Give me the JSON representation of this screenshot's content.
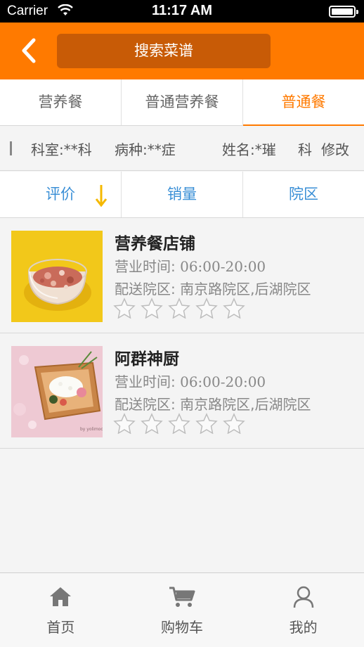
{
  "status_bar": {
    "carrier": "Carrier",
    "time": "11:17 AM"
  },
  "header": {
    "search_label": "搜索菜谱"
  },
  "tabs": [
    {
      "label": "营养餐",
      "active": false
    },
    {
      "label": "普通营养餐",
      "active": false
    },
    {
      "label": "普通餐",
      "active": true
    }
  ],
  "info": {
    "department": "科室:**科",
    "disease": "病种:**症",
    "name": "姓名:*璀",
    "partial": "科",
    "edit": "修改"
  },
  "sort": {
    "rating": "评价",
    "sales": "销量",
    "campus": "院区"
  },
  "shops": [
    {
      "name": "营养餐店铺",
      "hours_label": "营业时间:",
      "hours": "06:00-20:00",
      "delivery_label": "配送院区:",
      "delivery": "南京路院区,后湖院区",
      "rating": 0
    },
    {
      "name": "阿群神厨",
      "hours_label": "营业时间:",
      "hours": "06:00-20:00",
      "delivery_label": "配送院区:",
      "delivery": "南京路院区,后湖院区",
      "rating": 0
    }
  ],
  "bottom_nav": [
    {
      "label": "首页",
      "icon": "home-icon"
    },
    {
      "label": "购物车",
      "icon": "cart-icon"
    },
    {
      "label": "我的",
      "icon": "user-icon"
    }
  ],
  "colors": {
    "accent": "#ff7a00",
    "search_bg": "#c85b06",
    "sort_blue": "#3a8fd6",
    "arrow_yellow": "#f5b800"
  }
}
